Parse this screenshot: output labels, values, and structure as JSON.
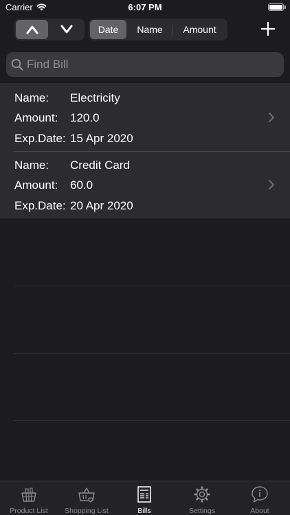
{
  "status_bar": {
    "carrier": "Carrier",
    "time": "6:07 PM",
    "battery_level": 1.0
  },
  "toolbar": {
    "order_buttons": [
      {
        "icon": "chevron-up-icon",
        "selected": true
      },
      {
        "icon": "chevron-down-icon",
        "selected": false
      }
    ],
    "sort_options": [
      "Date",
      "Name",
      "Amount"
    ],
    "selected_sort": "Date",
    "add_icon": "plus-icon"
  },
  "search": {
    "placeholder": "Find Bill",
    "value": ""
  },
  "bills": [
    {
      "name_label": "Name:",
      "name": "Electricity",
      "amount_label": "Amount:",
      "amount": "120.0",
      "date_label": "Exp.Date:",
      "date": "15 Apr 2020"
    },
    {
      "name_label": "Name:",
      "name": "Credit Card",
      "amount_label": "Amount:",
      "amount": "60.0",
      "date_label": "Exp.Date:",
      "date": "20 Apr 2020"
    }
  ],
  "tab_bar": {
    "tabs": [
      {
        "label": "Product List",
        "icon": "basket-icon",
        "active": false
      },
      {
        "label": "Shopping List",
        "icon": "shopping-basket-heart-icon",
        "active": false
      },
      {
        "label": "Bills",
        "icon": "bill-document-icon",
        "active": true
      },
      {
        "label": "Settings",
        "icon": "gear-icon",
        "active": false
      },
      {
        "label": "About",
        "icon": "info-bubble-icon",
        "active": false
      }
    ]
  },
  "colors": {
    "background": "#1c1c1e",
    "row_background": "#2c2c2e",
    "selected_segment": "#636366",
    "inactive_tab": "#8e8e93",
    "active_tab": "#ffffff"
  }
}
